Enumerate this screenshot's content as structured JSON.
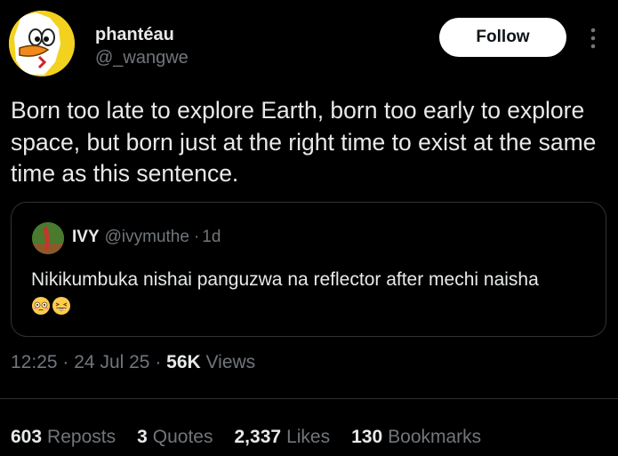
{
  "author": {
    "display_name": "phantéau",
    "handle": "@_wangwe",
    "avatar_icon": "duck-avatar-icon"
  },
  "follow_label": "Follow",
  "tweet": {
    "text": "Born too late to explore Earth, born too early to explore space, but born just at the right time to exist at the same time as this sentence."
  },
  "quote": {
    "name": "IVY",
    "handle": "@ivymuthe",
    "separator": "·",
    "time": "1d",
    "text": "Nikikumbuka nishai panguzwa na reflector after mechi naisha",
    "emojis": [
      "flushed-face-emoji",
      "grinning-squinting-face-emoji"
    ]
  },
  "meta": {
    "time": "12:25",
    "sep1": "·",
    "date": "24 Jul 25",
    "sep2": "·",
    "views_count": "56K",
    "views_label": "Views"
  },
  "stats": {
    "reposts_count": "603",
    "reposts_label": "Reposts",
    "quotes_count": "3",
    "quotes_label": "Quotes",
    "likes_count": "2,337",
    "likes_label": "Likes",
    "bookmarks_count": "130",
    "bookmarks_label": "Bookmarks"
  },
  "colors": {
    "background": "#000000",
    "text_primary": "#e7e9ea",
    "text_secondary": "#71767b",
    "border": "#2f3336",
    "avatar_bg": "#f2d21e"
  }
}
